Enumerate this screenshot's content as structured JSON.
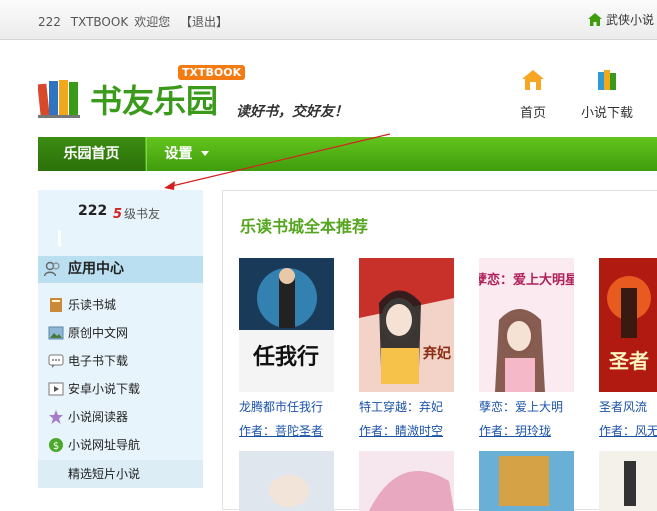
{
  "topbar": {
    "user_id": "222",
    "site_code": "TXTBOOK",
    "welcome": "欢迎您",
    "logout": "【退出】",
    "right_link": "武侠小说"
  },
  "logo": {
    "name": "书友乐园",
    "badge": "TXTBOOK",
    "slogan": "读好书，交好友！"
  },
  "header_nav": [
    {
      "label": "首页",
      "icon": "home-icon"
    },
    {
      "label": "小说下载",
      "icon": "books-download-icon"
    }
  ],
  "navbar": {
    "home": "乐园首页",
    "settings": "设置"
  },
  "sidebar": {
    "username": "222",
    "level_num": "5",
    "level_text": "级书友",
    "app_center": "应用中心",
    "items": [
      {
        "label": "乐读书城",
        "icon": "book-icon"
      },
      {
        "label": "原创中文网",
        "icon": "picture-icon"
      },
      {
        "label": "电子书下载",
        "icon": "chat-icon"
      },
      {
        "label": "安卓小说下载",
        "icon": "play-icon"
      },
      {
        "label": "小说阅读器",
        "icon": "star-icon"
      },
      {
        "label": "小说网址导航",
        "icon": "money-icon"
      },
      {
        "label": "精选短片小说",
        "icon": ""
      }
    ]
  },
  "main": {
    "section_title": "乐读书城全本推荐",
    "books": [
      {
        "title": "龙腾都市任我行",
        "author": "作者：菩陀圣者",
        "cover_text": "任我行"
      },
      {
        "title": "特工穿越：弃妃",
        "author": "作者：睛溦时空",
        "cover_text": "弃妃"
      },
      {
        "title": "孽恋：爱上大明",
        "author": "作者：玥玲珑",
        "cover_text": "孽恋：爱上大明星"
      },
      {
        "title": "圣者风流",
        "author": "作者：风无",
        "cover_text": "圣者"
      }
    ]
  },
  "colors": {
    "green_nav": "#4fae14",
    "green_dark": "#2c7009",
    "link_blue": "#1a52a8",
    "sidebar_bg": "#e8f4fb"
  }
}
